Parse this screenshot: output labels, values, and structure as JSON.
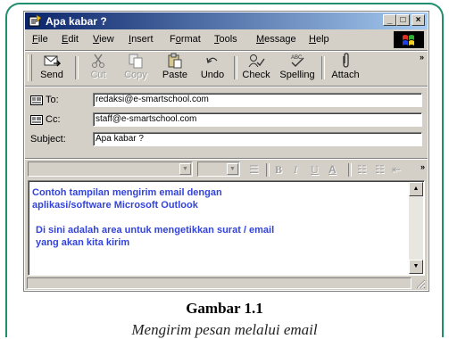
{
  "window": {
    "title": "Apa kabar ?",
    "controls": {
      "minimize": "_",
      "maximize": "□",
      "close": "×"
    }
  },
  "menubar": {
    "items": [
      {
        "label": "File",
        "underline": "F"
      },
      {
        "label": "Edit",
        "underline": "E"
      },
      {
        "label": "View",
        "underline": "V"
      },
      {
        "label": "Insert",
        "underline": "I"
      },
      {
        "label": "Format",
        "underline": "o"
      },
      {
        "label": "Tools",
        "underline": "T"
      },
      {
        "label": "Message",
        "underline": "M"
      },
      {
        "label": "Help",
        "underline": "H"
      }
    ]
  },
  "toolbar": {
    "send": "Send",
    "cut": "Cut",
    "copy": "Copy",
    "paste": "Paste",
    "undo": "Undo",
    "check": "Check",
    "spelling": "Spelling",
    "attach": "Attach",
    "overflow": "»"
  },
  "header": {
    "to_label": "To:",
    "to_value": "redaksi@e-smartschool.com",
    "cc_label": "Cc:",
    "cc_value": "staff@e-smartschool.com",
    "subject_label": "Subject:",
    "subject_value": "Apa kabar ?"
  },
  "format_toolbar": {
    "bold": "B",
    "italic": "I",
    "underline": "U",
    "color": "A",
    "overflow": "»"
  },
  "message_body": {
    "paragraph1_line1": "Contoh tampilan mengirim email dengan",
    "paragraph1_line2": "aplikasi/software Microsoft Outlook",
    "paragraph2_line1": "Di sini adalah area untuk mengetikkan surat / email",
    "paragraph2_line2": "yang akan kita kirim",
    "text_color": "#3344dd"
  },
  "caption": {
    "title": "Gambar 1.1",
    "subtitle": "Mengirim pesan melalui email"
  },
  "colors": {
    "frame_border": "#1f8f6e",
    "titlebar_start": "#0a246a",
    "titlebar_end": "#a6caf0"
  }
}
